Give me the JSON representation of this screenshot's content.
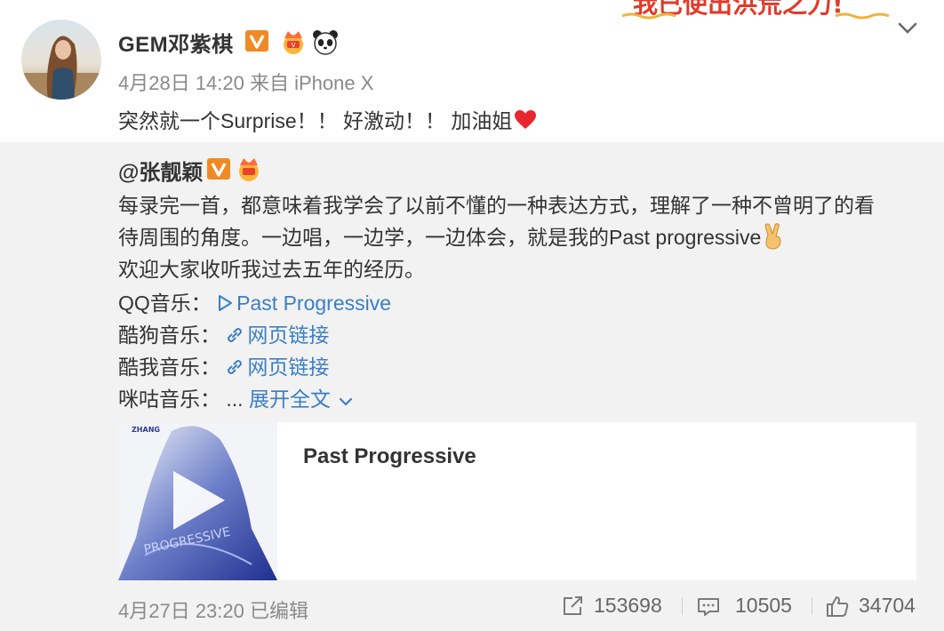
{
  "post": {
    "username": "GEM邓紫棋",
    "meta": "4月28日 14:20 来自 iPhone X",
    "text": "突然就一个Surprise！！ 好激动！！ 加油姐"
  },
  "banner": {
    "text": "我已使出洪荒之力!"
  },
  "repost": {
    "username": "@张靓颖",
    "lines": [
      "每录完一首，都意味着我学会了以前不懂的一种表达方式，理解了一种不曾明了的看",
      "待周围的角度。一边唱，一边学，一边体会，就是我的Past progressive",
      "欢迎大家收听我过去五年的经历。"
    ],
    "links": [
      {
        "label": "QQ音乐：",
        "link_text": "Past Progressive",
        "icon": "play-icon"
      },
      {
        "label": "酷狗音乐：",
        "link_text": "网页链接",
        "icon": "link-icon"
      },
      {
        "label": "酷我音乐：",
        "link_text": "网页链接",
        "icon": "link-icon"
      },
      {
        "label": "咪咕音乐：",
        "prefix": "... ",
        "link_text": "展开全文",
        "icon": "chevron-down-icon"
      }
    ],
    "card": {
      "title": "Past Progressive",
      "thumb_label": "ZHANG",
      "thumb_watermark": "PROGRESSIVE"
    },
    "footer": {
      "meta": "4月27日 23:20   已编辑",
      "repost_count": "153698",
      "comment_count": "10505",
      "like_count": "34704"
    }
  },
  "colors": {
    "link": "#3b7fc4",
    "repost_bg": "#f2f2f2",
    "verified_badge": "#f08a24",
    "meta_text": "#8a8a8a"
  }
}
